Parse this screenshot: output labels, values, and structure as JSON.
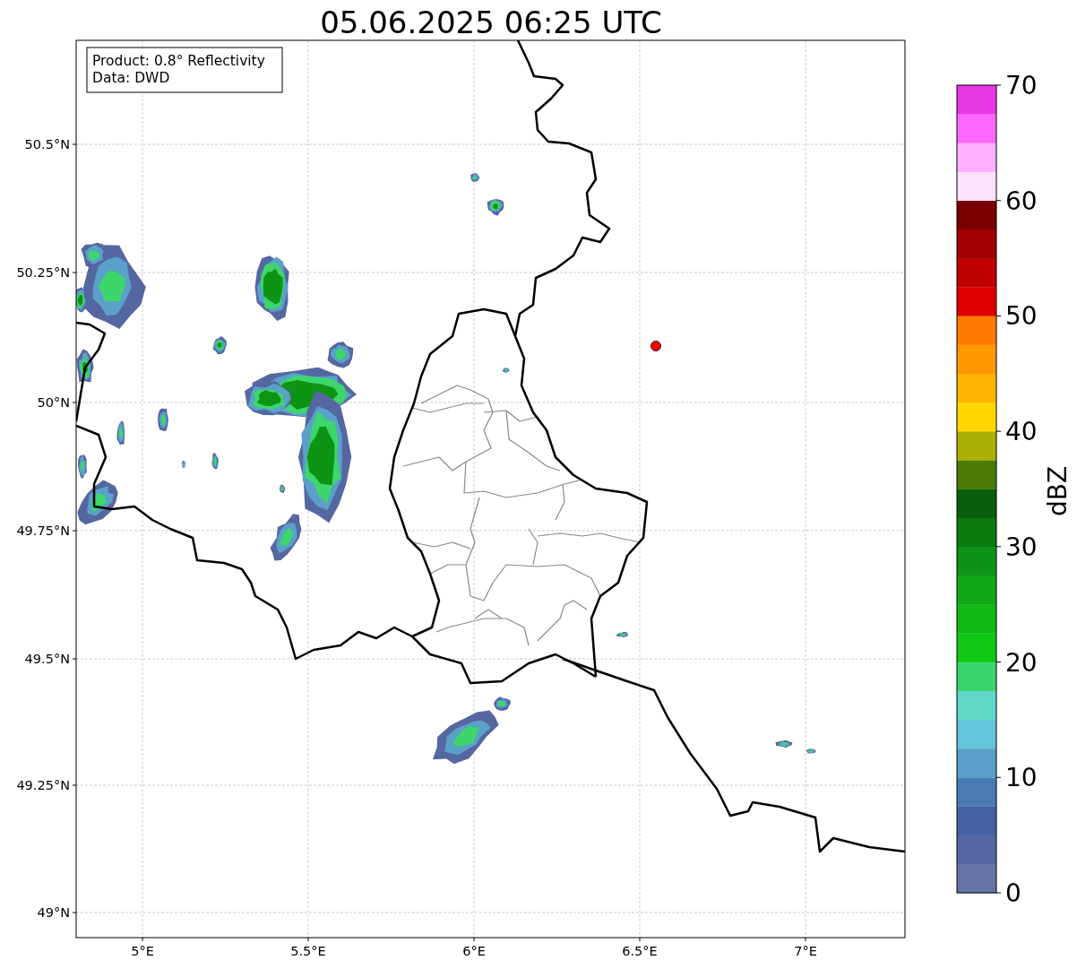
{
  "title": "05.06.2025 06:25 UTC",
  "info_box": [
    "Product: 0.8° Reflectivity",
    "Data: DWD"
  ],
  "map": {
    "xticks": [
      "5°E",
      "5.5°E",
      "6°E",
      "6.5°E",
      "7°E"
    ],
    "yticks": [
      "50.5°N",
      "50.25°N",
      "50°N",
      "49.75°N",
      "49.5°N",
      "49.25°N",
      "49°N"
    ]
  },
  "colorbar": {
    "label": "dBZ",
    "ticks": [
      "70",
      "60",
      "50",
      "40",
      "30",
      "20",
      "10",
      "0"
    ],
    "segments": [
      {
        "color": "#6673a6"
      },
      {
        "color": "#5567a0"
      },
      {
        "color": "#4560a3"
      },
      {
        "color": "#4a7ab2"
      },
      {
        "color": "#5aa0c8"
      },
      {
        "color": "#66c3dc"
      },
      {
        "color": "#5fd8c8"
      },
      {
        "color": "#3dd66c"
      },
      {
        "color": "#10c814"
      },
      {
        "color": "#10b814"
      },
      {
        "color": "#10a814"
      },
      {
        "color": "#0e9414"
      },
      {
        "color": "#0a7a0e"
      },
      {
        "color": "#085e0a"
      },
      {
        "color": "#4a7a08"
      },
      {
        "color": "#aab004"
      },
      {
        "color": "#ffd700"
      },
      {
        "color": "#ffb400"
      },
      {
        "color": "#ff9800"
      },
      {
        "color": "#ff7c00"
      },
      {
        "color": "#e00000"
      },
      {
        "color": "#c00000"
      },
      {
        "color": "#a00000"
      },
      {
        "color": "#7a0000"
      },
      {
        "color": "#ffe0ff"
      },
      {
        "color": "#ffb0ff"
      },
      {
        "color": "#ff68ff"
      },
      {
        "color": "#e838e8"
      }
    ]
  }
}
